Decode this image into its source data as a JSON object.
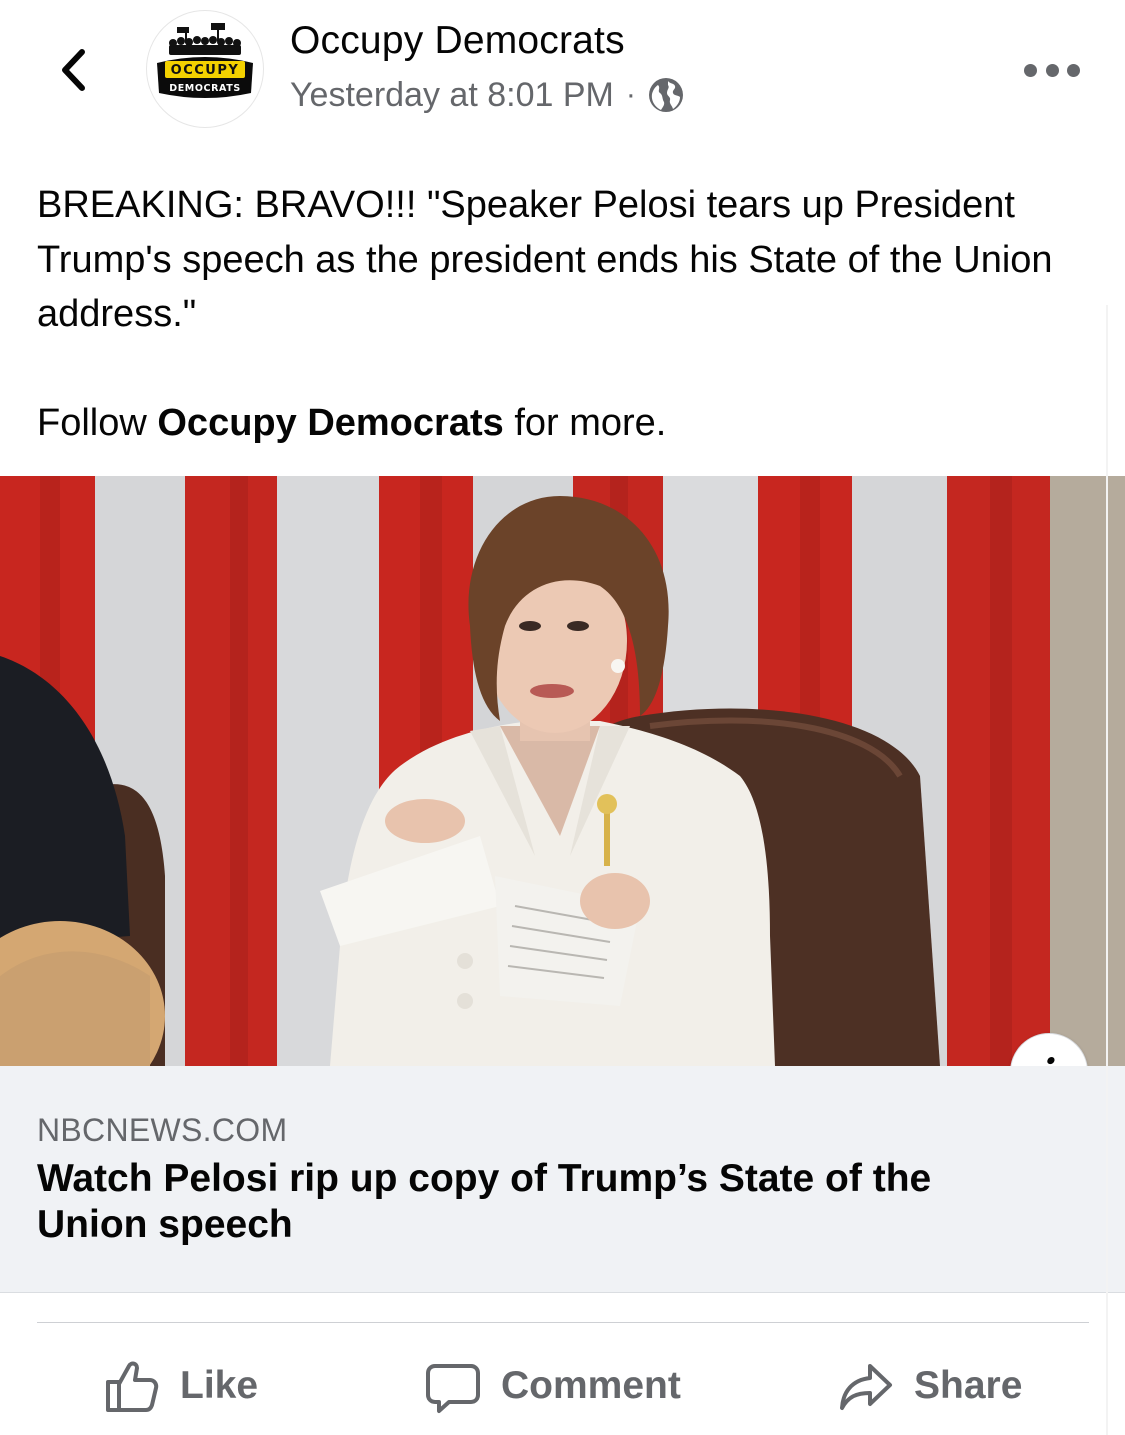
{
  "header": {
    "back_icon": "chevron-left-icon",
    "avatar": {
      "logo_text_top": "OCCUPY",
      "logo_text_bottom": "DEMOCRATS"
    },
    "page_name": "Occupy Democrats",
    "timestamp": "Yesterday at 8:01 PM",
    "separator": "·",
    "privacy_icon": "globe-icon",
    "more_icon": "more-horizontal-icon"
  },
  "post": {
    "line1": "BREAKING: BRAVO!!! \"Speaker Pelosi tears up President Trump's speech as the president ends his State of the Union address.\"",
    "follow_prefix": "Follow",
    "follow_page": "Occupy Democrats",
    "follow_suffix": "for more."
  },
  "photo": {
    "info_icon": "info-icon",
    "info_glyph": "i"
  },
  "link_preview": {
    "domain": "NBCNEWS.COM",
    "title": "Watch Pelosi rip up copy of Trump’s State of the Union speech"
  },
  "actions": {
    "like": {
      "label": "Like",
      "icon": "thumbs-up-icon"
    },
    "comment": {
      "label": "Comment",
      "icon": "comment-bubble-icon"
    },
    "share": {
      "label": "Share",
      "icon": "share-arrow-icon"
    }
  },
  "colors": {
    "text_primary": "#050505",
    "text_secondary": "#65676b",
    "card_background": "#f0f2f5",
    "flag_red": "#c8261f",
    "flag_white": "#d9dadc"
  }
}
